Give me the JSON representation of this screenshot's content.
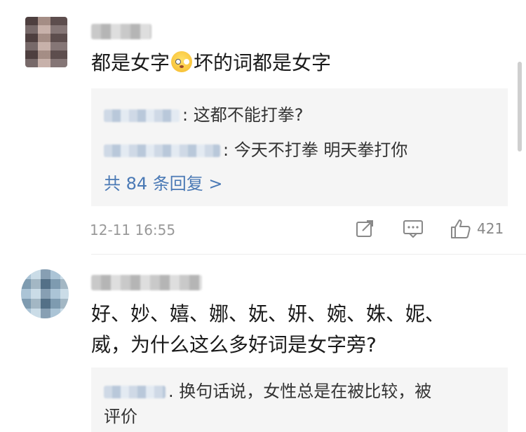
{
  "comments": [
    {
      "content_before_emoji": "都是女字",
      "emoji_icon": "flushed-face-icon",
      "content_after_emoji": "坏的词都是女字",
      "replies": [
        {
          "text": ": 这都不能打拳?"
        },
        {
          "text": ": 今天不打拳 明天拳打你"
        }
      ],
      "more_replies": "共 84 条回复 >",
      "timestamp": "12-11 16:55",
      "like_count": "421"
    },
    {
      "content_line1": "好、妙、嬉、娜、妩、妍、婉、姝、妮、",
      "content_line2": "威，为什么这么多好词是女字旁?",
      "replies": [
        {
          "text_line1": ". 换句话说，女性总是在被比较，被",
          "text_line2": "评价"
        }
      ]
    }
  ],
  "icons": {
    "share": "share-icon",
    "comment": "comment-icon",
    "like": "thumbs-up-icon"
  }
}
